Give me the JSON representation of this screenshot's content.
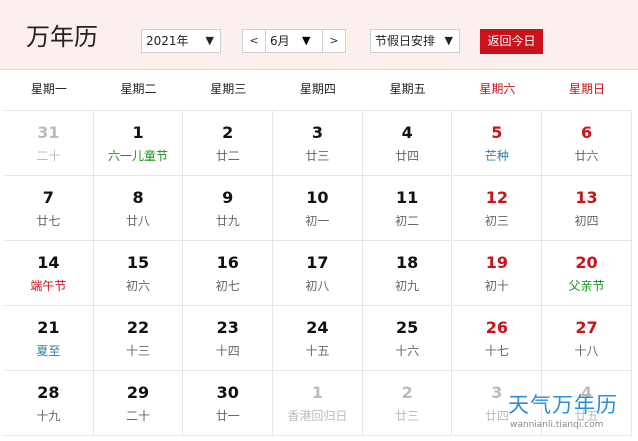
{
  "header": {
    "title": "万年历",
    "year_value": "2021年",
    "month_value": "6月",
    "prev_label": "<",
    "next_label": ">",
    "holiday_value": "节假日安排",
    "today_button": "返回今日",
    "dropdown_arrow": "▼"
  },
  "weekdays": [
    "星期一",
    "星期二",
    "星期三",
    "星期四",
    "星期五",
    "星期六",
    "星期日"
  ],
  "days": [
    {
      "num": "31",
      "sub": "二十",
      "other": true
    },
    {
      "num": "1",
      "sub": "六一儿童节",
      "subtype": "festival"
    },
    {
      "num": "2",
      "sub": "廿二"
    },
    {
      "num": "3",
      "sub": "廿三"
    },
    {
      "num": "4",
      "sub": "廿四"
    },
    {
      "num": "5",
      "sub": "芒种",
      "subtype": "term",
      "weekend": true
    },
    {
      "num": "6",
      "sub": "廿六",
      "weekend": true
    },
    {
      "num": "7",
      "sub": "廿七"
    },
    {
      "num": "8",
      "sub": "廿八"
    },
    {
      "num": "9",
      "sub": "廿九"
    },
    {
      "num": "10",
      "sub": "初一"
    },
    {
      "num": "11",
      "sub": "初二"
    },
    {
      "num": "12",
      "sub": "初三",
      "weekend": true
    },
    {
      "num": "13",
      "sub": "初四",
      "weekend": true
    },
    {
      "num": "14",
      "sub": "端午节",
      "subtype": "holiday-red"
    },
    {
      "num": "15",
      "sub": "初六"
    },
    {
      "num": "16",
      "sub": "初七"
    },
    {
      "num": "17",
      "sub": "初八"
    },
    {
      "num": "18",
      "sub": "初九"
    },
    {
      "num": "19",
      "sub": "初十",
      "weekend": true
    },
    {
      "num": "20",
      "sub": "父亲节",
      "subtype": "festival",
      "weekend": true
    },
    {
      "num": "21",
      "sub": "夏至",
      "subtype": "term"
    },
    {
      "num": "22",
      "sub": "十三"
    },
    {
      "num": "23",
      "sub": "十四"
    },
    {
      "num": "24",
      "sub": "十五"
    },
    {
      "num": "25",
      "sub": "十六"
    },
    {
      "num": "26",
      "sub": "十七",
      "weekend": true
    },
    {
      "num": "27",
      "sub": "十八",
      "weekend": true
    },
    {
      "num": "28",
      "sub": "十九"
    },
    {
      "num": "29",
      "sub": "二十"
    },
    {
      "num": "30",
      "sub": "廿一"
    },
    {
      "num": "1",
      "sub": "香港回归日",
      "other": true
    },
    {
      "num": "2",
      "sub": "廿三",
      "other": true
    },
    {
      "num": "3",
      "sub": "廿四",
      "other": true
    },
    {
      "num": "4",
      "sub": "廿五",
      "other": true
    }
  ],
  "watermark": {
    "title": "天气万年历",
    "url": "wannianli.tianqi.com"
  },
  "colors": {
    "accent": "#c9121a",
    "festival": "#1a8f1a",
    "solar_term": "#2f7fa8",
    "header_bg": "#fbf0ee"
  }
}
